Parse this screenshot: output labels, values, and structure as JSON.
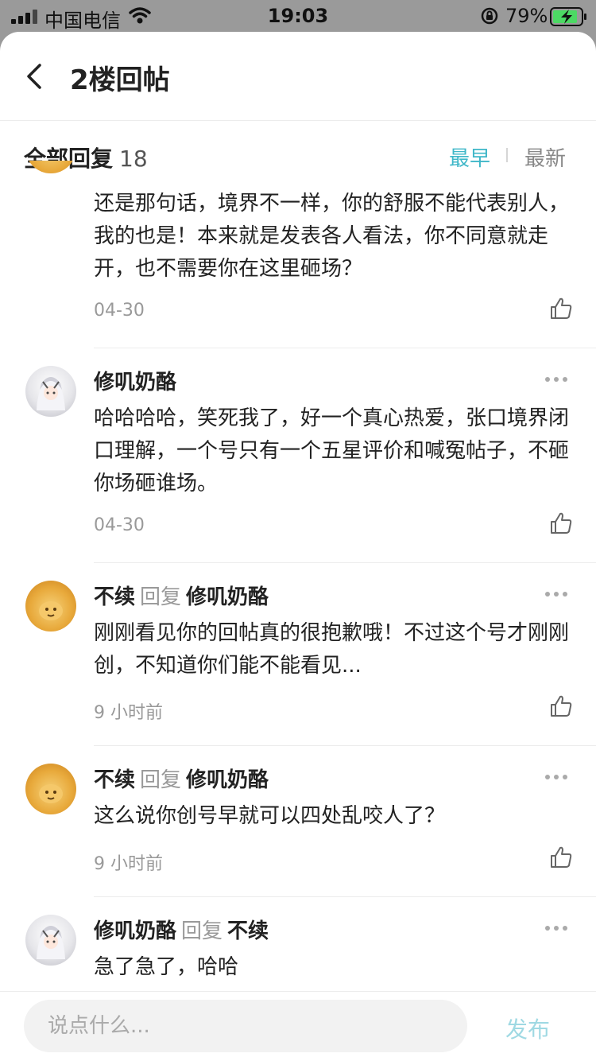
{
  "status_bar": {
    "carrier": "中国电信",
    "time": "19:03",
    "battery": "79%"
  },
  "header": {
    "title": "2楼回帖"
  },
  "subheader": {
    "all_replies_label": "全部回复",
    "count": "18",
    "sort_early": "最早",
    "sort_new": "最新"
  },
  "replies": [
    {
      "name": "",
      "reply_to": "",
      "content": "还是那句话，境界不一样，你的舒服不能代表别人，我的也是！本来就是发表各人看法，你不同意就走开，也不需要你在这里砸场？",
      "date": "04-30"
    },
    {
      "name": "修叽奶酪",
      "reply_to": "",
      "content": "哈哈哈哈，笑死我了，好一个真心热爱，张口境界闭口理解，一个号只有一个五星评价和喊冤帖子，不砸你场砸谁场。",
      "date": "04-30"
    },
    {
      "name": "不续",
      "reply_word": "回复",
      "reply_to": "修叽奶酪",
      "content": "刚刚看见你的回帖真的很抱歉哦！不过这个号才刚刚创，不知道你们能不能看见...",
      "date": "9 小时前"
    },
    {
      "name": "不续",
      "reply_word": "回复",
      "reply_to": "修叽奶酪",
      "content": "这么说你创号早就可以四处乱咬人了？",
      "date": "9 小时前"
    },
    {
      "name": "修叽奶酪",
      "reply_word": "回复",
      "reply_to": "不续",
      "content": "急了急了，哈哈",
      "date": ""
    }
  ],
  "bottom_bar": {
    "input_placeholder": "说点什么...",
    "publish_label": "发布"
  },
  "colors": {
    "accent": "#3fb7c8",
    "publish_disabled": "#9fd9e3",
    "muted": "#999999"
  }
}
